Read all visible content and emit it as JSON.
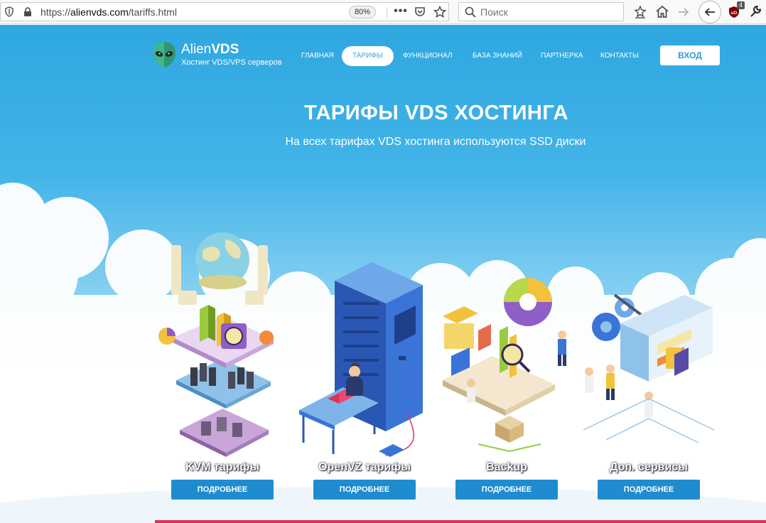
{
  "browser": {
    "url_scheme": "https://",
    "url_host": "alienvds.com",
    "url_path": "/tariffs.html",
    "zoom": "80%",
    "search_placeholder": "Поиск",
    "ublock_count": "4"
  },
  "site": {
    "brand_light": "Alien",
    "brand_bold": "VDS",
    "tagline": "Хостинг VDS/VPS серверов",
    "nav": [
      {
        "label": "ГЛАВНАЯ"
      },
      {
        "label": "ТАРИФЫ",
        "active": true
      },
      {
        "label": "ФУНКЦИОНАЛ"
      },
      {
        "label": "БАЗА ЗНАНИЙ"
      },
      {
        "label": "ПАРТНЕРКА"
      },
      {
        "label": "КОНТАКТЫ"
      }
    ],
    "login_label": "ВХОД"
  },
  "hero": {
    "title": "ТАРИФЫ VDS ХОСТИНГА",
    "subtitle": "На всех тарифах VDS хостинга используются SSD диски"
  },
  "cards": [
    {
      "title": "KVM тарифы",
      "button": "ПОДРОБНЕЕ",
      "illustration": "kvm-stack-illustration"
    },
    {
      "title": "OpenVZ тарифы",
      "button": "ПОДРОБНЕЕ",
      "illustration": "server-rack-illustration"
    },
    {
      "title": "Backup",
      "button": "ПОДРОБНЕЕ",
      "illustration": "backup-illustration"
    },
    {
      "title": "Доп. сервисы",
      "button": "ПОДРОБНЕЕ",
      "illustration": "services-illustration"
    }
  ],
  "colors": {
    "sky_top": "#2ea7e0",
    "accent": "#1f8ccf",
    "brand_green": "#3fb68b",
    "strip": "#d9335a"
  }
}
